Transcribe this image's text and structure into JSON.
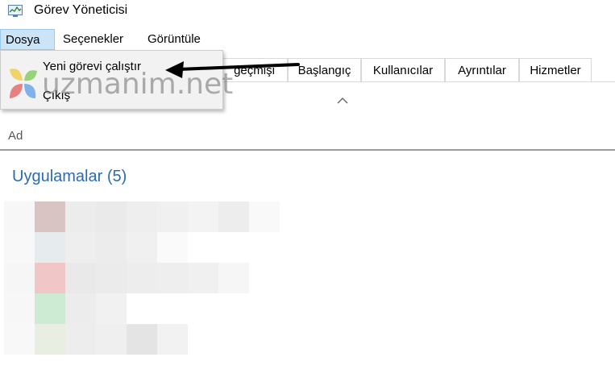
{
  "window": {
    "title": "Görev Yöneticisi"
  },
  "menu": {
    "items": [
      {
        "label": "Dosya",
        "active": true
      },
      {
        "label": "Seçenekler",
        "active": false
      },
      {
        "label": "Görüntüle",
        "active": false
      }
    ]
  },
  "file_menu": {
    "items": [
      {
        "label": "Yeni görevi çalıştır"
      },
      {
        "label": "Çıkış"
      }
    ]
  },
  "tabs": [
    {
      "label": "geçmişi"
    },
    {
      "label": "Başlangıç"
    },
    {
      "label": "Kullanıcılar"
    },
    {
      "label": "Ayrıntılar"
    },
    {
      "label": "Hizmetler"
    }
  ],
  "table": {
    "column_name": "Ad",
    "group_title": "Uygulamalar (5)"
  },
  "watermark": {
    "text": "uzmanim.net"
  },
  "colors": {
    "accent": "#2b6cb0",
    "menu_active_bg": "#cce4f7",
    "menu_active_border": "#99c9ef"
  }
}
